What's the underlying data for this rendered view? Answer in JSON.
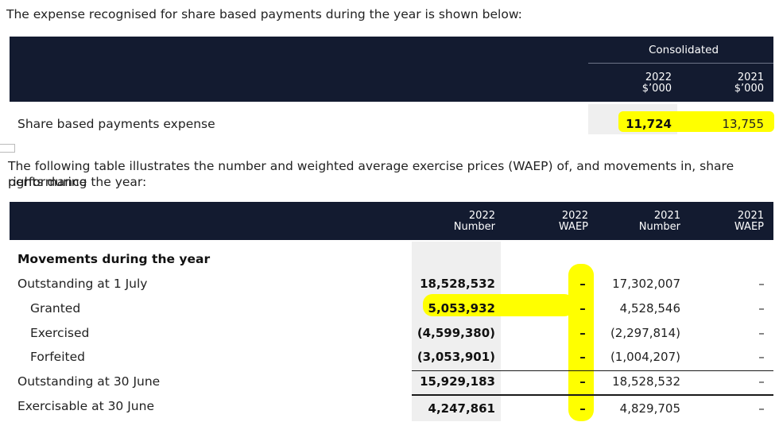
{
  "intro1": "The expense recognised for share based payments during the year is shown below:",
  "t1": {
    "group": "Consolidated",
    "col_a_year": "2022",
    "col_a_unit": "$’000",
    "col_b_year": "2021",
    "col_b_unit": "$’000",
    "row_label": "Share based payments expense",
    "val_a": "11,724",
    "val_b": "13,755"
  },
  "intro2_line1": "The following table illustrates the number and weighted average exercise prices (WAEP) of, and movements in, share performance",
  "intro2_line2": "rights during the year:",
  "t2": {
    "headers": [
      {
        "year": "2022",
        "label": "Number"
      },
      {
        "year": "2022",
        "label": "WAEP"
      },
      {
        "year": "2021",
        "label": "Number"
      },
      {
        "year": "2021",
        "label": "WAEP"
      }
    ],
    "section_title": "Movements during the year",
    "rows": [
      {
        "label": "Outstanding at 1 July",
        "n2022": "18,528,532",
        "w2022": "–",
        "n2021": "17,302,007",
        "w2021": "–"
      },
      {
        "label": "Granted",
        "n2022": "5,053,932",
        "w2022": "–",
        "n2021": "4,528,546",
        "w2021": "–"
      },
      {
        "label": "Exercised",
        "n2022": "(4,599,380)",
        "w2022": "–",
        "n2021": "(2,297,814)",
        "w2021": "–"
      },
      {
        "label": "Forfeited",
        "n2022": "(3,053,901)",
        "w2022": "–",
        "n2021": "(1,004,207)",
        "w2021": "–"
      },
      {
        "label": "Outstanding at 30 June",
        "n2022": "15,929,183",
        "w2022": "–",
        "n2021": "18,528,532",
        "w2021": "–"
      },
      {
        "label": "Exercisable at 30 June",
        "n2022": "4,247,861",
        "w2022": "–",
        "n2021": "4,829,705",
        "w2021": "–"
      }
    ]
  },
  "colors": {
    "band": "#131b30",
    "highlight": "#ffff00",
    "shade": "#efefef"
  }
}
